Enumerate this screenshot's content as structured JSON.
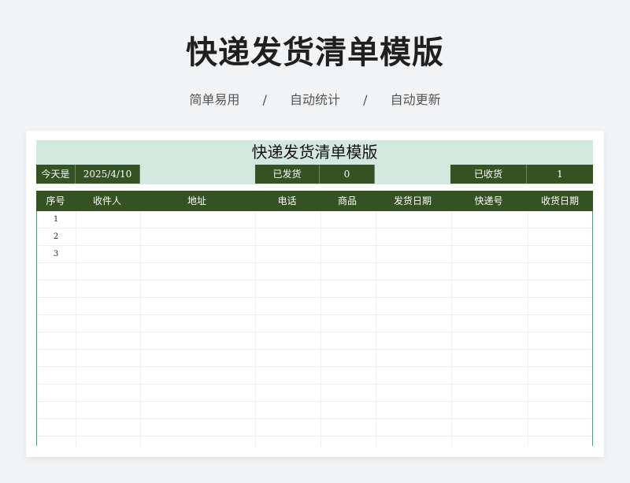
{
  "hero": {
    "title": "快递发货清单模版",
    "features": [
      "简单易用",
      "自动统计",
      "自动更新"
    ],
    "separator": "/"
  },
  "sheet": {
    "title": "快递发货清单模版",
    "today_label": "今天是",
    "today_value": "2025/4/10",
    "shipped_label": "已发货",
    "shipped_value": "0",
    "received_label": "已收货",
    "received_value": "1",
    "columns": [
      "序号",
      "收件人",
      "地址",
      "电话",
      "商品",
      "发货日期",
      "快递号",
      "收货日期"
    ],
    "rows": [
      {
        "index": "1"
      },
      {
        "index": "2"
      },
      {
        "index": "3"
      },
      {
        "index": ""
      },
      {
        "index": ""
      },
      {
        "index": ""
      },
      {
        "index": ""
      },
      {
        "index": ""
      },
      {
        "index": ""
      },
      {
        "index": ""
      },
      {
        "index": ""
      },
      {
        "index": ""
      },
      {
        "index": ""
      },
      {
        "index": ""
      }
    ]
  }
}
